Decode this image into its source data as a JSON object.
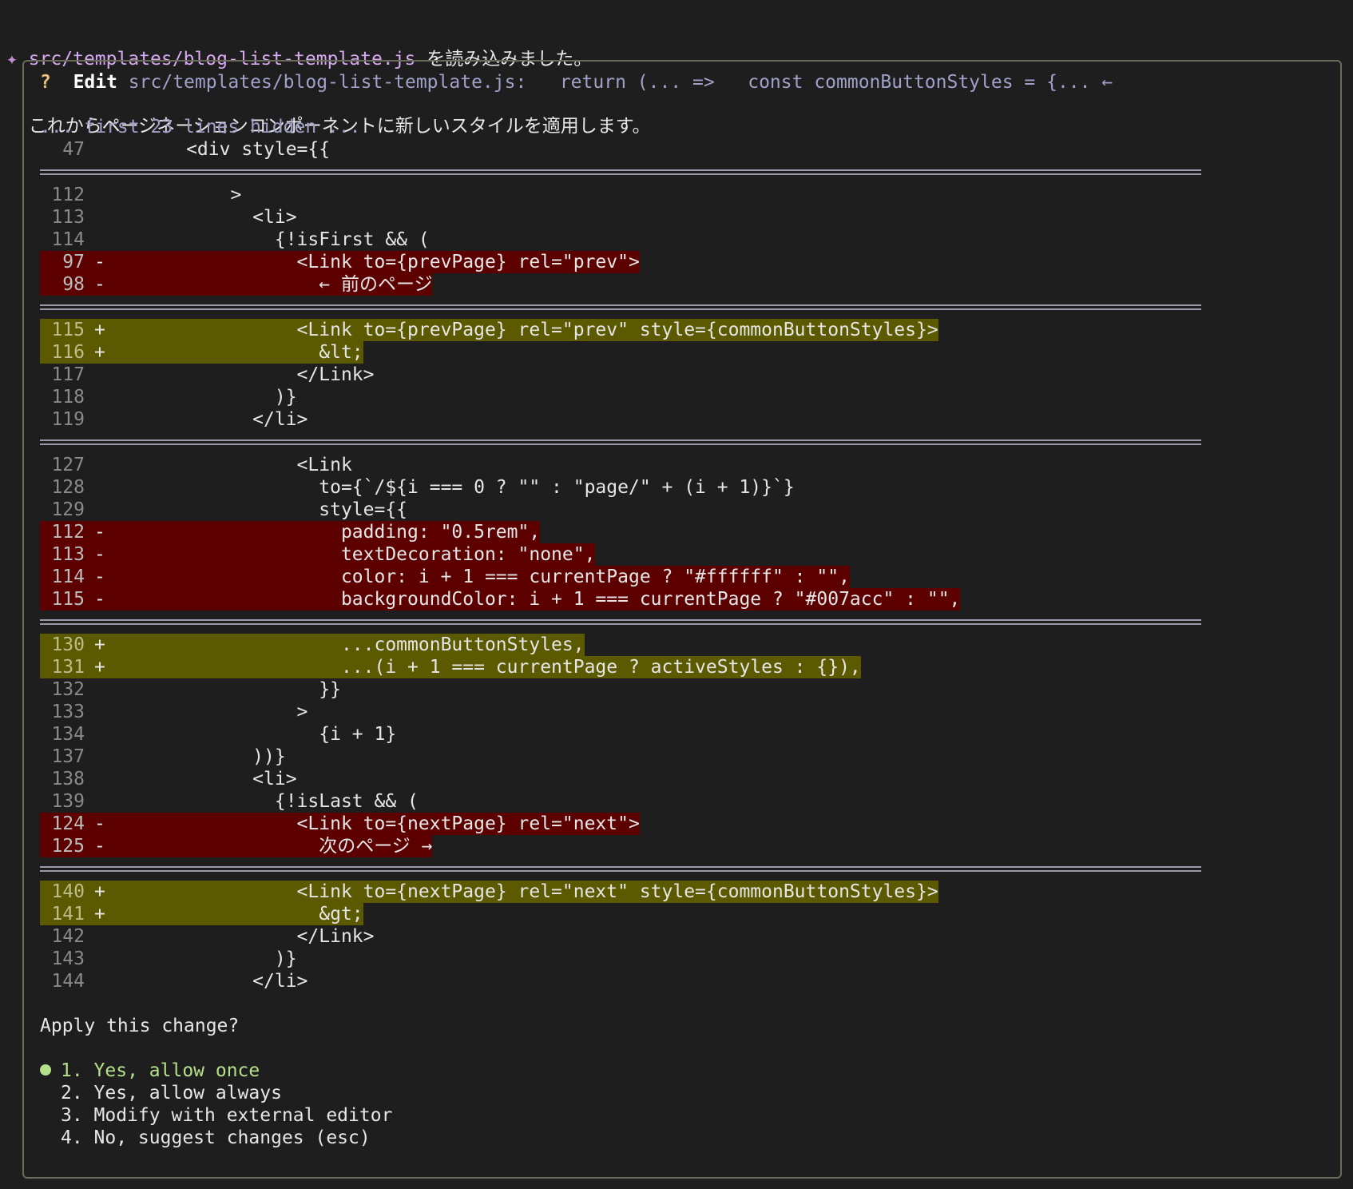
{
  "message": {
    "star": "✦",
    "file": "src/templates/blog-list-template.js",
    "line1_suffix": " を読み込みました。",
    "line2": "これからページネーションコンポーネントに新しいスタイルを適用します。"
  },
  "dialog": {
    "q": "?",
    "edit": "Edit",
    "title_rest": " src/templates/blog-list-template.js:   return (... =>   const commonButtonStyles = {... ←",
    "hidden_note": "... first 23 lines hidden ...",
    "lines": [
      {
        "n": "47",
        "mk": "",
        "t": "      <div style={{",
        "type": "ctx"
      },
      {
        "sep": true
      },
      {
        "n": "112",
        "mk": "",
        "t": "          >",
        "type": "ctx"
      },
      {
        "n": "113",
        "mk": "",
        "t": "            <li>",
        "type": "ctx"
      },
      {
        "n": "114",
        "mk": "",
        "t": "              {!isFirst && (",
        "type": "ctx"
      },
      {
        "n": "97",
        "mk": "-",
        "t": "                <Link to={prevPage} rel=\"prev\">",
        "type": "del"
      },
      {
        "n": "98",
        "mk": "-",
        "t": "                  ← 前のページ",
        "type": "del"
      },
      {
        "sep": true
      },
      {
        "n": "115",
        "mk": "+",
        "t": "                <Link to={prevPage} rel=\"prev\" style={commonButtonStyles}>",
        "type": "add"
      },
      {
        "n": "116",
        "mk": "+",
        "t": "                  &lt;",
        "type": "add"
      },
      {
        "n": "117",
        "mk": "",
        "t": "                </Link>",
        "type": "ctx"
      },
      {
        "n": "118",
        "mk": "",
        "t": "              )}",
        "type": "ctx"
      },
      {
        "n": "119",
        "mk": "",
        "t": "            </li>",
        "type": "ctx"
      },
      {
        "sep": true
      },
      {
        "n": "127",
        "mk": "",
        "t": "                <Link",
        "type": "ctx"
      },
      {
        "n": "128",
        "mk": "",
        "t": "                  to={`/${i === 0 ? \"\" : \"page/\" + (i + 1)}`}",
        "type": "ctx"
      },
      {
        "n": "129",
        "mk": "",
        "t": "                  style={{",
        "type": "ctx"
      },
      {
        "n": "112",
        "mk": "-",
        "t": "                    padding: \"0.5rem\",",
        "type": "del"
      },
      {
        "n": "113",
        "mk": "-",
        "t": "                    textDecoration: \"none\",",
        "type": "del"
      },
      {
        "n": "114",
        "mk": "-",
        "t": "                    color: i + 1 === currentPage ? \"#ffffff\" : \"\",",
        "type": "del"
      },
      {
        "n": "115",
        "mk": "-",
        "t": "                    backgroundColor: i + 1 === currentPage ? \"#007acc\" : \"\",",
        "type": "del"
      },
      {
        "sep": true
      },
      {
        "n": "130",
        "mk": "+",
        "t": "                    ...commonButtonStyles,",
        "type": "add"
      },
      {
        "n": "131",
        "mk": "+",
        "t": "                    ...(i + 1 === currentPage ? activeStyles : {}),",
        "type": "add"
      },
      {
        "n": "132",
        "mk": "",
        "t": "                  }}",
        "type": "ctx"
      },
      {
        "n": "133",
        "mk": "",
        "t": "                >",
        "type": "ctx"
      },
      {
        "n": "134",
        "mk": "",
        "t": "                  {i + 1}",
        "type": "ctx"
      },
      {
        "n": "137",
        "mk": "",
        "t": "            ))}",
        "type": "ctx"
      },
      {
        "n": "138",
        "mk": "",
        "t": "            <li>",
        "type": "ctx"
      },
      {
        "n": "139",
        "mk": "",
        "t": "              {!isLast && (",
        "type": "ctx"
      },
      {
        "n": "124",
        "mk": "-",
        "t": "                <Link to={nextPage} rel=\"next\">",
        "type": "del"
      },
      {
        "n": "125",
        "mk": "-",
        "t": "                  次のページ →",
        "type": "del"
      },
      {
        "sep": true
      },
      {
        "n": "140",
        "mk": "+",
        "t": "                <Link to={nextPage} rel=\"next\" style={commonButtonStyles}>",
        "type": "add"
      },
      {
        "n": "141",
        "mk": "+",
        "t": "                  &gt;",
        "type": "add"
      },
      {
        "n": "142",
        "mk": "",
        "t": "                </Link>",
        "type": "ctx"
      },
      {
        "n": "143",
        "mk": "",
        "t": "              )}",
        "type": "ctx"
      },
      {
        "n": "144",
        "mk": "",
        "t": "            </li>",
        "type": "ctx"
      }
    ],
    "prompt": "Apply this change?",
    "options": [
      {
        "label": "1. Yes, allow once",
        "selected": true
      },
      {
        "label": "2. Yes, allow always",
        "selected": false
      },
      {
        "label": "3. Modify with external editor",
        "selected": false
      },
      {
        "label": "4. No, suggest changes (esc)",
        "selected": false
      }
    ]
  }
}
